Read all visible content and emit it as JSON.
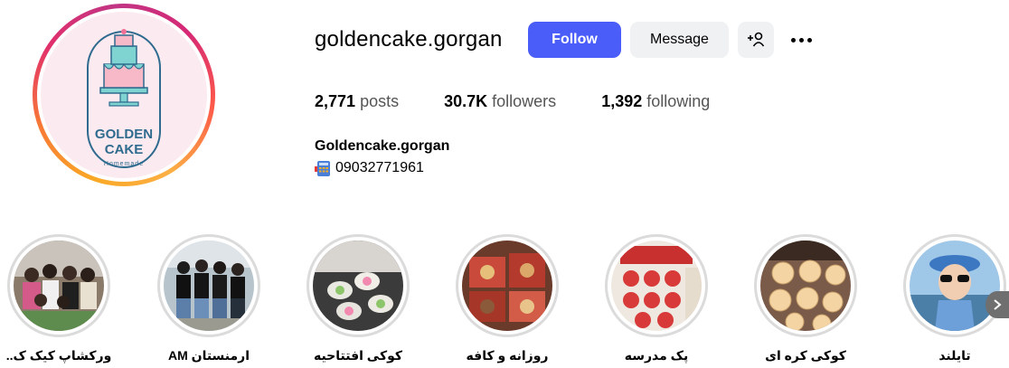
{
  "profile": {
    "username": "goldencake.gorgan",
    "full_name": "Goldencake.gorgan",
    "bio_phone": "09032771961",
    "avatar": {
      "logo_line1": "GOLDEN",
      "logo_line2": "CAKE",
      "logo_sub": "Homemade"
    }
  },
  "actions": {
    "follow": "Follow",
    "message": "Message"
  },
  "stats": {
    "posts_count": "2,771",
    "posts_label": "posts",
    "followers_count": "30.7K",
    "followers_label": "followers",
    "following_count": "1,392",
    "following_label": "following"
  },
  "highlights": [
    {
      "label": "ورکشاپ کیک ک..",
      "theme": "group-photo"
    },
    {
      "label": "ارمنستان AM",
      "theme": "group-photo-2"
    },
    {
      "label": "کوکی افتتاحیه",
      "theme": "cookies-green"
    },
    {
      "label": "روزانه و کافه",
      "theme": "boxes-red"
    },
    {
      "label": "پک مدرسه",
      "theme": "cookies-red"
    },
    {
      "label": "کوکی کره ای",
      "theme": "butter-cookies"
    },
    {
      "label": "تایلند",
      "theme": "portrait"
    }
  ],
  "colors": {
    "follow_button": "#4a5df9",
    "secondary_button": "#eff1f3",
    "highlight_ring": "#dbdbdb"
  }
}
